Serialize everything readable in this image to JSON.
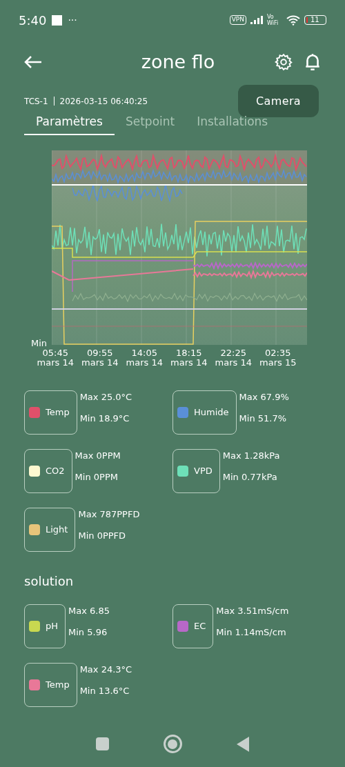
{
  "status_bar": {
    "time": "5:40",
    "more": "···",
    "vpn": "VPN",
    "network": "Vo WiFi",
    "battery": "11"
  },
  "header": {
    "title": "zone flo"
  },
  "device": {
    "id": "TCS-1",
    "timestamp": "2026-03-15 06:40:25",
    "camera_button": "Camera"
  },
  "tabs": [
    {
      "label": "Paramètres",
      "selected": true
    },
    {
      "label": "Setpoint",
      "selected": false
    },
    {
      "label": "Installations",
      "selected": false
    }
  ],
  "chart": {
    "min_label": "Min",
    "x_labels": [
      {
        "time": "05:45",
        "date": "mars 14"
      },
      {
        "time": "09:55",
        "date": "mars 14"
      },
      {
        "time": "14:05",
        "date": "mars 14"
      },
      {
        "time": "18:15",
        "date": "mars 14"
      },
      {
        "time": "22:25",
        "date": "mars 14"
      },
      {
        "time": "02:35",
        "date": "mars 15"
      }
    ]
  },
  "sensors": [
    {
      "name": "Temp",
      "color": "#e0506a",
      "max": "Max 25.0°C",
      "min": "Min 18.9°C"
    },
    {
      "name": "Humide",
      "color": "#5a8fd8",
      "max": "Max 67.9%",
      "min": "Min 51.7%"
    },
    {
      "name": "CO2",
      "color": "#fdf8d0",
      "max": "Max 0PPM",
      "min": "Min 0PPM"
    },
    {
      "name": "VPD",
      "color": "#6ee0b8",
      "max": "Max 1.28kPa",
      "min": "Min 0.77kPa"
    },
    {
      "name": "Light",
      "color": "#e8c47a",
      "max": "Max 787PPFD",
      "min": "Min 0PPFD"
    }
  ],
  "solution": {
    "title": "solution",
    "sensors": [
      {
        "name": "pH",
        "color": "#c8d850",
        "max": "Max 6.85",
        "min": "Min 5.96"
      },
      {
        "name": "EC",
        "color": "#b868c8",
        "max": "Max 3.51mS/cm",
        "min": "Min 1.14mS/cm"
      },
      {
        "name": "Temp",
        "color": "#e87898",
        "max": "Max 24.3°C",
        "min": "Min 13.6°C"
      }
    ]
  }
}
